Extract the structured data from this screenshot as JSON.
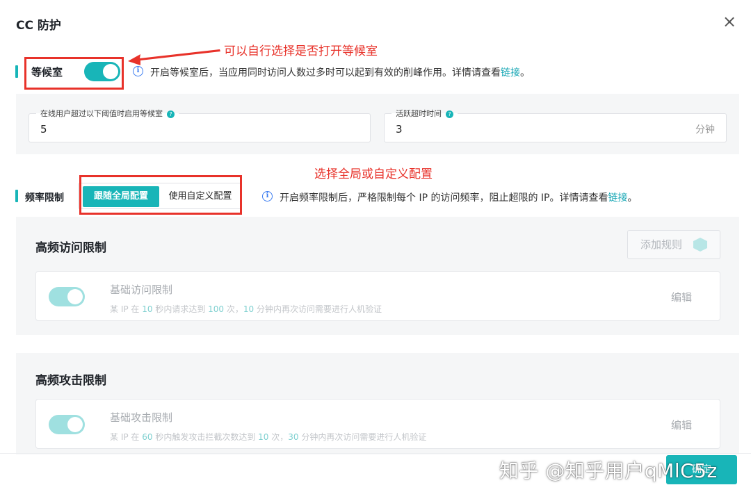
{
  "dialog": {
    "title": "CC 防护",
    "close_glyph": "×"
  },
  "waiting_room": {
    "label": "等候室",
    "enabled": true,
    "info_text": "开启等候室后，当应用同时访问人数过多时可以起到有效的削峰作用。详情请查看",
    "info_link": "链接",
    "info_tail": "。",
    "threshold_field": {
      "label": "在线用户超过以下阈值时启用等候室",
      "value": "5"
    },
    "timeout_field": {
      "label": "活跃超时时间",
      "value": "3",
      "unit": "分钟"
    }
  },
  "annotations": {
    "waiting_room_note": "可以自行选择是否打开等候室",
    "config_note": "选择全局或自定义配置"
  },
  "frequency_limit": {
    "label": "频率限制",
    "options": [
      "跟随全局配置",
      "使用自定义配置"
    ],
    "selected": "跟随全局配置",
    "info_text": "开启频率限制后，严格限制每个 IP 的访问频率，阻止超限的 IP。详情请查看",
    "info_link": "链接",
    "info_tail": "。"
  },
  "high_freq_access": {
    "title": "高频访问限制",
    "add_rule_label": "添加规则",
    "rule": {
      "name": "基础访问限制",
      "desc_prefix": "某 IP 在 ",
      "seconds": "10",
      "desc_mid1": " 秒内请求达到 ",
      "count": "100",
      "desc_mid2": " 次，",
      "minutes": "10",
      "desc_tail": " 分钟内再次访问需要进行人机验证",
      "edit_label": "编辑",
      "enabled": true
    }
  },
  "high_freq_attack": {
    "title": "高频攻击限制",
    "rule": {
      "name": "基础攻击限制",
      "desc_prefix": "某 IP 在 ",
      "seconds": "60",
      "desc_mid1": " 秒内触发攻击拦截次数达到 ",
      "count": "10",
      "desc_mid2": " 次，",
      "minutes": "30",
      "desc_tail": " 分钟内再次访问需要进行人机验证",
      "edit_label": "编辑",
      "enabled": true
    }
  },
  "footer": {
    "button_label": "确定"
  },
  "watermark": "知乎 @知乎用户qMlC5z",
  "colors": {
    "accent": "#18b5b8",
    "annotation_red": "#e8322a",
    "link": "#18a7b5",
    "info_blue": "#3b7cf0"
  }
}
